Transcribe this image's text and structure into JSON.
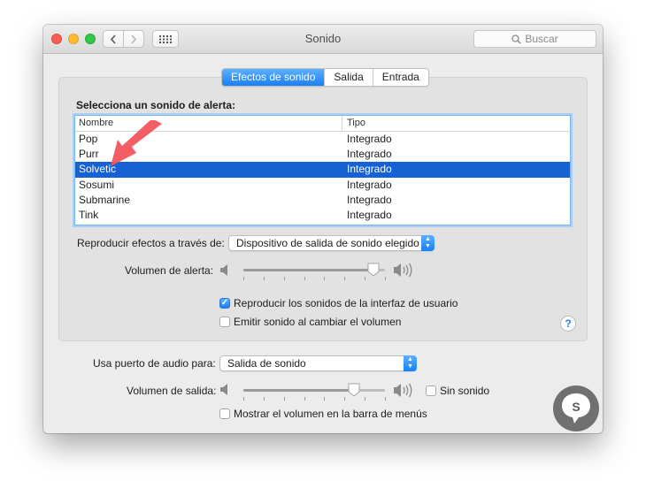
{
  "window": {
    "title": "Sonido",
    "search_placeholder": "Buscar",
    "nav": {
      "back_icon": "chevron-left-icon",
      "forward_icon": "chevron-right-icon",
      "grid_icon": "grid-icon"
    }
  },
  "tabs": [
    {
      "label": "Efectos de sonido",
      "active": true
    },
    {
      "label": "Salida",
      "active": false
    },
    {
      "label": "Entrada",
      "active": false
    }
  ],
  "alert": {
    "heading": "Selecciona un sonido de alerta:",
    "columns": [
      "Nombre",
      "Tipo"
    ],
    "rows": [
      {
        "name": "Pop",
        "type": "Integrado",
        "selected": false
      },
      {
        "name": "Purr",
        "type": "Integrado",
        "selected": false
      },
      {
        "name": "Solvetic",
        "type": "Integrado",
        "selected": true
      },
      {
        "name": "Sosumi",
        "type": "Integrado",
        "selected": false
      },
      {
        "name": "Submarine",
        "type": "Integrado",
        "selected": false
      },
      {
        "name": "Tink",
        "type": "Integrado",
        "selected": false
      }
    ],
    "play_through_label": "Reproducir efectos a través de:",
    "play_through_value": "Dispositivo de salida de sonido elegido",
    "volume_label": "Volumen de alerta:",
    "volume_value": 0.92,
    "ui_sounds_label": "Reproducir los sonidos de la interfaz de usuario",
    "ui_sounds_checked": true,
    "feedback_label": "Emitir sonido al cambiar el volumen",
    "feedback_checked": false
  },
  "output": {
    "port_label": "Usa puerto de audio para:",
    "port_value": "Salida de sonido",
    "volume_label": "Volumen de salida:",
    "volume_value": 0.78,
    "mute_label": "Sin sonido",
    "mute_checked": false,
    "menubar_label": "Mostrar el volumen en la barra de menús",
    "menubar_checked": false
  },
  "colors": {
    "accent": "#1a7ff5",
    "selection": "#1661d4",
    "annotation_arrow": "#f2555c"
  }
}
